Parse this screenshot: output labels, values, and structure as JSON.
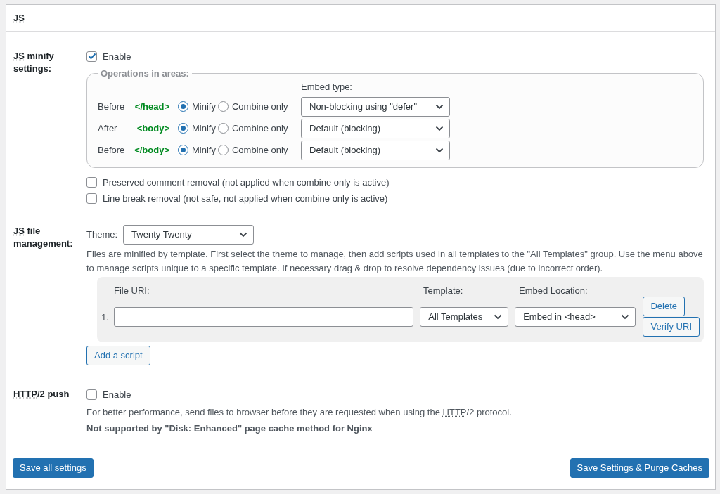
{
  "panel": {
    "title_abbr": "JS"
  },
  "minify": {
    "label": {
      "abbr": "JS",
      "text": " minify settings:"
    },
    "enable": {
      "label": "Enable",
      "checked": true
    },
    "areas_legend": "Operations in areas:",
    "embed_header": "Embed type:",
    "areas": [
      {
        "position": "Before",
        "tag": "</head>",
        "options": [
          {
            "label": "Minify",
            "selected": true
          },
          {
            "label": "Combine only",
            "selected": false
          }
        ],
        "embed_type": "Non-blocking using \"defer\""
      },
      {
        "position": "After",
        "tag": "<body>",
        "options": [
          {
            "label": "Minify",
            "selected": true
          },
          {
            "label": "Combine only",
            "selected": false
          }
        ],
        "embed_type": "Default (blocking)"
      },
      {
        "position": "Before",
        "tag": "</body>",
        "options": [
          {
            "label": "Minify",
            "selected": true
          },
          {
            "label": "Combine only",
            "selected": false
          }
        ],
        "embed_type": "Default (blocking)"
      }
    ],
    "extra_options": [
      {
        "label": "Preserved comment removal (not applied when combine only is active)",
        "checked": false
      },
      {
        "label": "Line break removal (not safe, not applied when combine only is active)",
        "checked": false
      }
    ]
  },
  "file_management": {
    "label": {
      "abbr": "JS",
      "text": " file management:"
    },
    "theme_label": "Theme:",
    "theme": "Twenty Twenty",
    "description": "Files are minified by template. First select the theme to manage, then add scripts used in all templates to the \"All Templates\" group. Use the menu above to manage scripts unique to a specific template. If necessary drag & drop to resolve dependency issues (due to incorrect order).",
    "columns": [
      "File URI:",
      "Template:",
      "Embed Location:"
    ],
    "rows": [
      {
        "number": "1.",
        "template": "All Templates",
        "embed_location": "Embed in <head>",
        "buttons": [
          "Delete",
          "Verify URI"
        ]
      }
    ],
    "add_button": "Add a script"
  },
  "http2": {
    "label": {
      "abbr": "HTTP",
      "text": "/2 push"
    },
    "enable": {
      "label": "Enable",
      "checked": false
    },
    "description": {
      "before": "For better performance, send files to browser before they are requested when using the ",
      "abbr": "HTTP",
      "after": "/2 protocol."
    },
    "note": "Not supported by \"Disk: Enhanced\" page cache method for Nginx"
  },
  "footer_buttons": [
    {
      "label": "Save all settings"
    },
    {
      "label": "Save Settings & Purge Caches"
    }
  ]
}
